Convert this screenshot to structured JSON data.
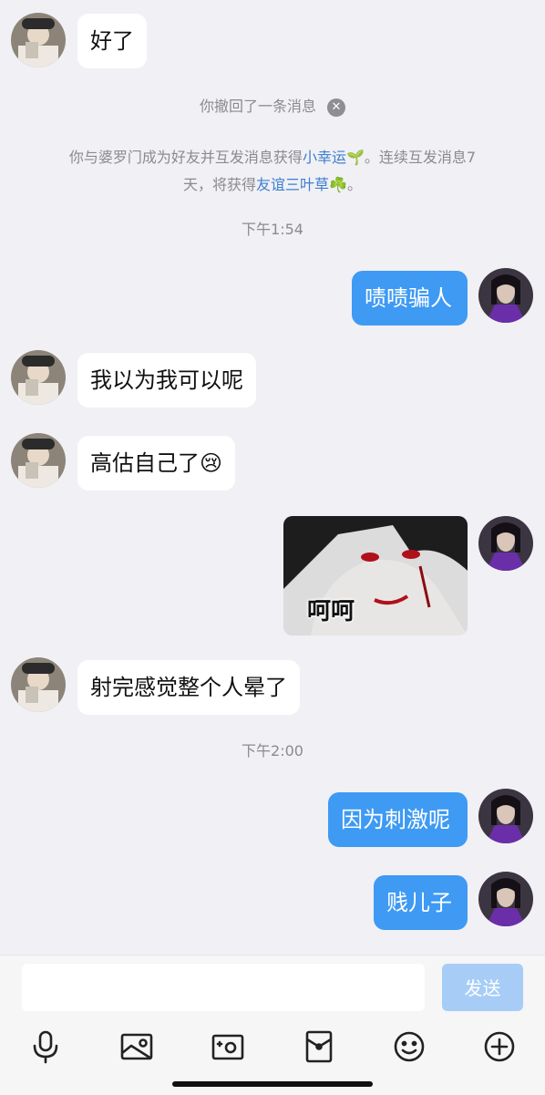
{
  "messages": {
    "m1": "好了",
    "m2": "啧啧骗人",
    "m3": "我以为我可以呢",
    "m4": "高估自己了😢",
    "m5_sticker_caption": "呵呵",
    "m6": "射完感觉整个人晕了",
    "m7": "因为刺激呢",
    "m8": "贱儿子"
  },
  "system": {
    "recall_notice": "你撤回了一条消息",
    "friend_notice_part1": "你与婆罗门成为好友并互发消息获得",
    "friend_notice_link1": "小幸运🌱",
    "friend_notice_part2": "。连续互发消息7",
    "friend_notice_part3": "天，将获得",
    "friend_notice_link2": "友谊三叶草☘️",
    "friend_notice_part4": "。",
    "time1": "下午1:54",
    "time2": "下午2:00"
  },
  "input": {
    "placeholder": "",
    "send_label": "发送"
  },
  "toolbar": {
    "icons": [
      "microphone-icon",
      "image-icon",
      "camera-icon",
      "red-packet-icon",
      "emoji-icon",
      "plus-icon"
    ]
  },
  "colors": {
    "background": "#f0f0f5",
    "outgoing_bubble": "#3e9af3",
    "incoming_bubble": "#ffffff",
    "link": "#3e7fcf",
    "send_disabled": "#a7cdf6"
  }
}
